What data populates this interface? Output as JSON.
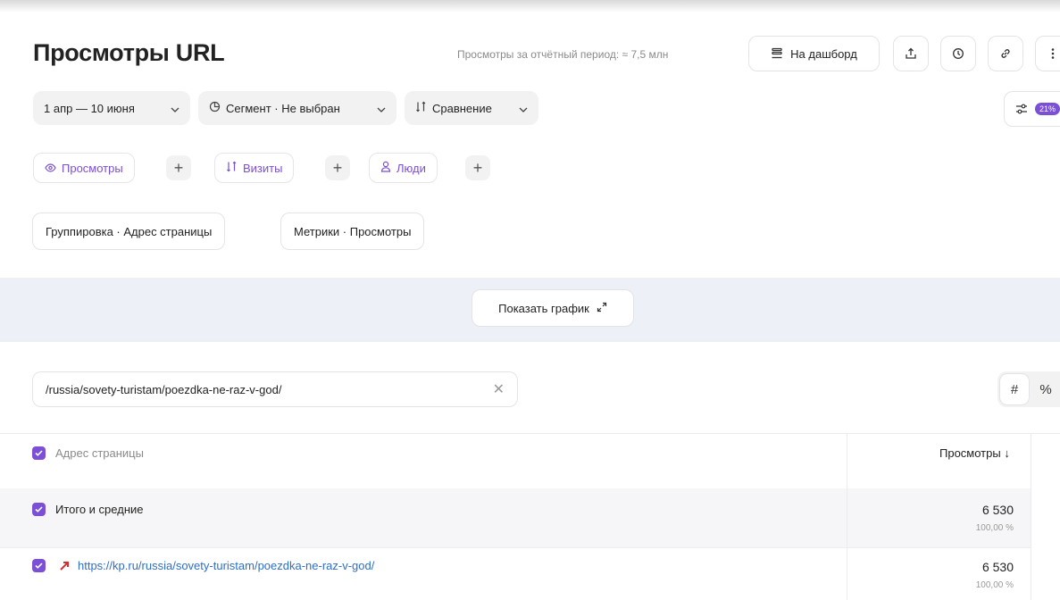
{
  "header": {
    "title": "Просмотры URL",
    "period_text": "Просмотры за отчётный период: ≈ 7,5 млн",
    "dashboard_label": "На дашборд",
    "icons": [
      "dashboard-icon",
      "export-icon",
      "history-icon",
      "link-icon",
      "more-icon"
    ]
  },
  "filters": {
    "date_range": "1 апр — 10 июня",
    "segment": "Сегмент · Не выбран",
    "comparison": "Сравнение",
    "badge": "21%"
  },
  "metric_chips": [
    {
      "label": "Просмотры",
      "icon": "eye-icon"
    },
    {
      "label": "Визиты",
      "icon": "visits-icon"
    },
    {
      "label": "Люди",
      "icon": "person-icon"
    }
  ],
  "settings": {
    "grouping": "Группировка · Адрес страницы",
    "metrics": "Метрики · Просмотры"
  },
  "chart_toggle": {
    "label": "Показать график"
  },
  "search": {
    "value": "/russia/sovety-turistam/poezdka-ne-raz-v-god/"
  },
  "view_toggle": {
    "abs": "#",
    "pct": "%"
  },
  "table": {
    "columns": [
      "Адрес страницы",
      "Просмотры ↓"
    ],
    "total": {
      "label": "Итого и средние",
      "value": "6 530",
      "percent": "100,00 %"
    },
    "rows": [
      {
        "url": "https://kp.ru/russia/sovety-turistam/poezdka-ne-raz-v-god/",
        "value": "6 530",
        "percent": "100,00 %"
      }
    ]
  },
  "colors": {
    "accent": "#7b4fd6",
    "link": "#2e6ec9",
    "band": "#eef0f7"
  }
}
